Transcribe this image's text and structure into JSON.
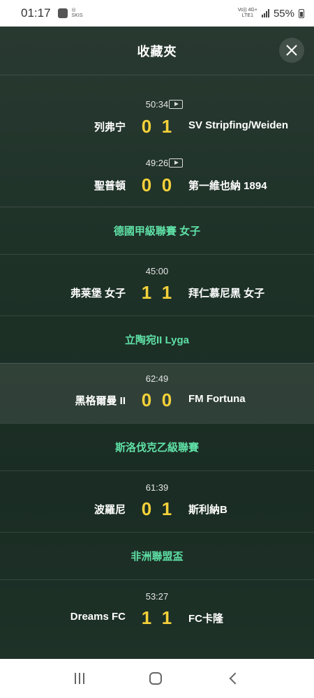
{
  "status_bar": {
    "time": "01:17",
    "network_top": "Vo)) 4G+",
    "network_bottom": "LTE1",
    "battery": "55%"
  },
  "header": {
    "title": "收藏夾"
  },
  "matches_group1": [
    {
      "clock": "50:34",
      "home": "列弗宁",
      "home_score": "0",
      "away_score": "1",
      "away": "SV Stripfing/Weiden",
      "has_video": true
    },
    {
      "clock": "49:26",
      "home": "聖普頓",
      "home_score": "0",
      "away_score": "0",
      "away": "第一維也納 1894",
      "has_video": true
    }
  ],
  "leagues": [
    {
      "name": "德國甲級聯賽 女子",
      "match": {
        "clock": "45:00",
        "home": "弗莱堡 女子",
        "home_score": "1",
        "away_score": "1",
        "away": "拜仁慕尼黑 女子"
      }
    },
    {
      "name": "立陶宛II Lyga",
      "match": {
        "clock": "62:49",
        "home": "黑格爾曼 II",
        "home_score": "0",
        "away_score": "0",
        "away": "FM Fortuna"
      }
    },
    {
      "name": "斯洛伐克乙級聯賽",
      "match": {
        "clock": "61:39",
        "home": "波羅尼",
        "home_score": "0",
        "away_score": "1",
        "away": "斯利納B"
      }
    },
    {
      "name": "非洲聯盟盃",
      "match": {
        "clock": "53:27",
        "home": "Dreams FC",
        "home_score": "1",
        "away_score": "1",
        "away": "FC卡隆"
      }
    }
  ],
  "colors": {
    "score": "#f4d13a",
    "league": "#5fe0a6"
  }
}
